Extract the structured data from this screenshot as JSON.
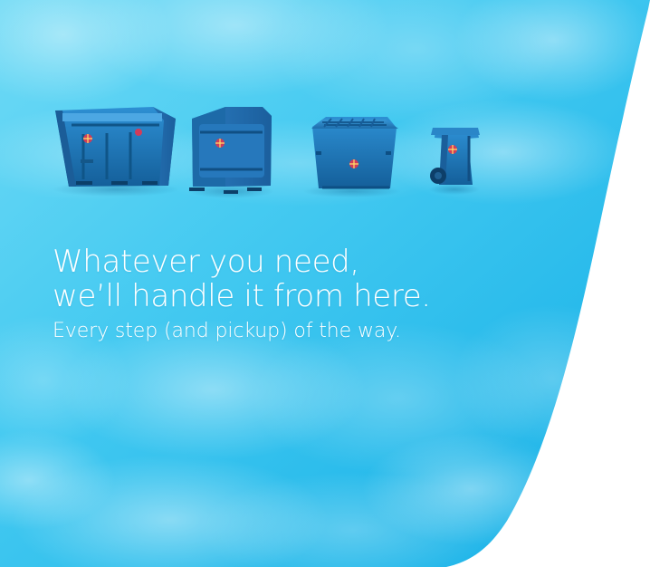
{
  "hero": {
    "headline_line_1": "Whatever you need,",
    "headline_line_2": "we’ll handle it from here.",
    "subheadline": "Every step (and pickup) of the way."
  },
  "colors": {
    "panel_light": "#62d6f4",
    "panel_mid": "#34c4ef",
    "panel_deep": "#12ace3",
    "text": "#ffffff",
    "container_blue": "#1a75b4",
    "container_dark": "#0e4f85",
    "logo_red": "#d23c59"
  },
  "illustration": {
    "containers": [
      "roll-off-dumpster-icon",
      "compactor-dumpster-icon",
      "front-load-dumpster-icon",
      "wheeled-cart-icon"
    ]
  }
}
